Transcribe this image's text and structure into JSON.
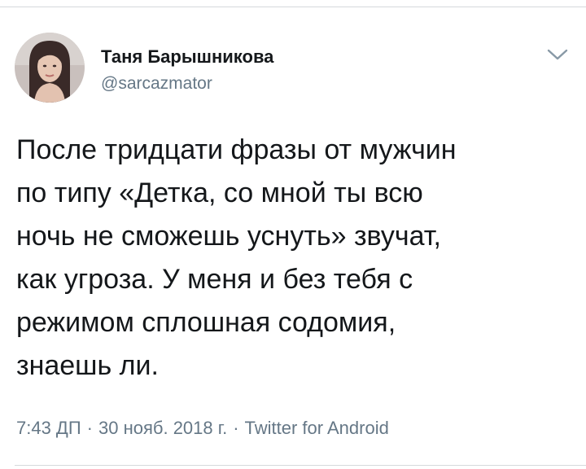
{
  "tweet": {
    "author": {
      "display_name": "Таня Барышникова",
      "username": "@sarcazmator"
    },
    "text_lines": [
      "После тридцати фразы от мужчин",
      "по типу «Детка, со мной ты всю",
      "ночь не сможешь уснуть» звучат,",
      "как угроза. У меня и без тебя с",
      "режимом сплошная содомия,",
      "знаешь ли."
    ],
    "time": "7:43 ДП",
    "date": "30 нояб. 2018 г.",
    "separator": "·",
    "source": "Twitter for Android"
  },
  "icons": {
    "menu": "chevron-down-icon",
    "avatar": "avatar"
  },
  "colors": {
    "text": "#14171a",
    "secondary": "#657786",
    "divider": "#d5d9dc",
    "chevron": "#8899a6"
  }
}
